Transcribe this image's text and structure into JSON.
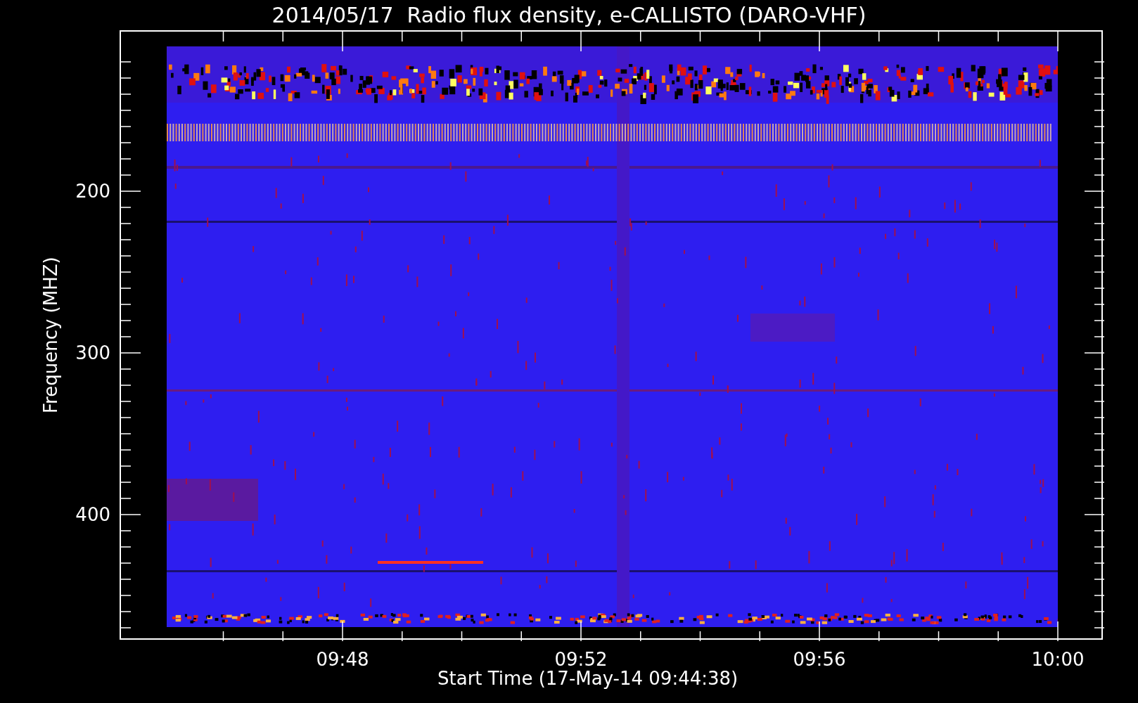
{
  "title": "2014/05/17  Radio flux density, e-CALLISTO (DARO-VHF)",
  "y_axis": {
    "label": "Frequency (MHZ)",
    "ticks": [
      "200",
      "300",
      "400"
    ]
  },
  "x_axis": {
    "label": "Start Time (17-May-14 09:44:38)",
    "ticks": [
      "09:48",
      "09:52",
      "09:56",
      "10:00"
    ]
  }
}
